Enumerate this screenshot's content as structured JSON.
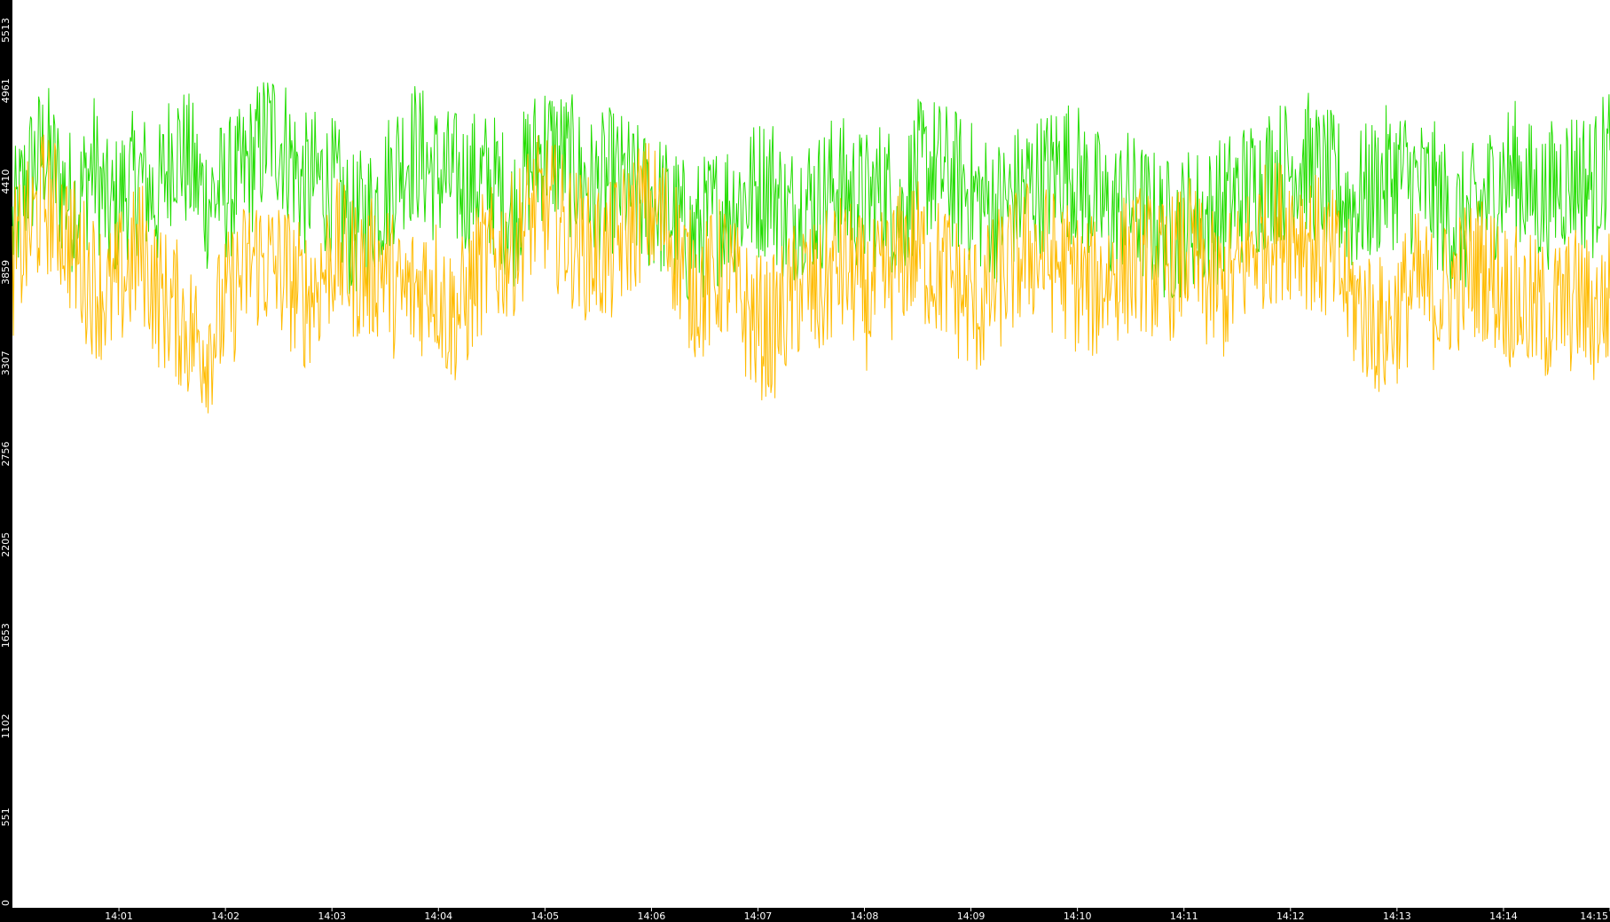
{
  "chart_data": {
    "type": "line",
    "title": "",
    "xlabel": "",
    "ylabel": "",
    "ylim": [
      0,
      5513
    ],
    "y_ticks": [
      "0",
      "551",
      "1102",
      "1653",
      "2205",
      "2756",
      "3307",
      "3859",
      "4410",
      "4961",
      "5513"
    ],
    "x_ticks": [
      "14:01",
      "14:02",
      "14:03",
      "14:04",
      "14:05",
      "14:06",
      "14:07",
      "14:08",
      "14:09",
      "14:10",
      "14:11",
      "14:12",
      "14:13",
      "14:14",
      "14:15"
    ],
    "x_range_minutes": [
      0,
      15
    ],
    "background": "#ffffff",
    "axis_color": "#000000",
    "grid": false,
    "legend": "none",
    "series": [
      {
        "color": "#22dd00",
        "values_sampled": [
          4120,
          4450,
          4610,
          4380,
          4250,
          4530,
          4180,
          4370,
          4420,
          4290,
          4650,
          4500,
          4300,
          4350,
          4400,
          4550,
          4720,
          4610,
          4380,
          4420,
          4350,
          4120,
          4200,
          4350,
          4540,
          4600,
          4480,
          4420,
          4390,
          4420,
          4380,
          4200,
          4500,
          4620,
          4560,
          4460,
          4350,
          4420,
          4380,
          4300,
          4280,
          4200,
          4060,
          4150,
          4250,
          4300,
          4350,
          4420,
          4180,
          4300,
          4290,
          4400,
          4330,
          4280,
          4380,
          4200,
          4460,
          4500,
          4440,
          4380,
          4290,
          4240,
          4300,
          4390,
          4410,
          4520,
          4450,
          4320,
          4200,
          4300,
          4220,
          4150,
          4100,
          4200,
          4180,
          4250,
          4330,
          4380,
          4460,
          4480,
          4550,
          4440,
          4380,
          4270,
          4330,
          4420,
          4460,
          4380,
          4350,
          4200,
          4150,
          4250,
          4400,
          4480,
          4350,
          4300,
          4420,
          4450,
          4380,
          4600
        ]
      },
      {
        "color": "#ffbb00",
        "values_sampled": [
          3900,
          4100,
          4300,
          4180,
          3950,
          3800,
          3700,
          3850,
          4000,
          3720,
          3650,
          3500,
          3420,
          3600,
          3800,
          3950,
          3900,
          3850,
          3700,
          3800,
          4000,
          3900,
          3850,
          3920,
          3700,
          3750,
          3850,
          3600,
          3650,
          3900,
          3950,
          4020,
          4200,
          4280,
          4150,
          4050,
          3980,
          3950,
          4100,
          4250,
          4200,
          4050,
          3800,
          3750,
          3900,
          3700,
          3550,
          3500,
          3650,
          3800,
          3700,
          3900,
          3850,
          3700,
          3800,
          3950,
          4000,
          3900,
          3850,
          3700,
          3650,
          3800,
          3900,
          4000,
          3950,
          3900,
          3800,
          3750,
          3850,
          3900,
          3950,
          3850,
          3900,
          4000,
          3800,
          3750,
          3850,
          4050,
          4100,
          4150,
          4100,
          4000,
          3900,
          3700,
          3600,
          3500,
          3650,
          3800,
          3700,
          3750,
          3850,
          3900,
          3800,
          3700,
          3650,
          3600,
          3650,
          3700,
          3600,
          3700
        ]
      }
    ]
  }
}
